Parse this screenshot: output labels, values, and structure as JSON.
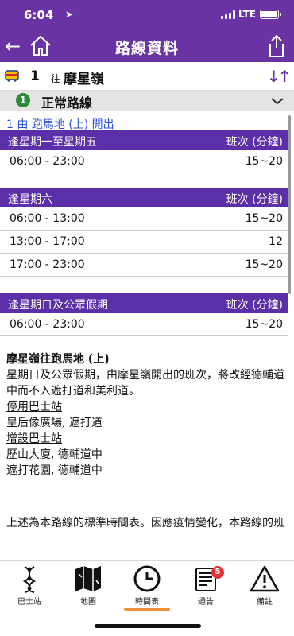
{
  "status_bar": {
    "time": "6:04",
    "network": "LTE"
  },
  "header": {
    "title": "路線資料"
  },
  "route": {
    "number": "1",
    "direction_prefix": "往",
    "destination": "摩星嶺"
  },
  "variant": {
    "index": "1",
    "label": "正常路線"
  },
  "origin_text": "1 由 跑馬地 (上) 開出",
  "timetable": [
    {
      "day_label": "逢星期一至星期五",
      "freq_label": "班次 (分鐘)",
      "rows": [
        {
          "time": "06:00 - 23:00",
          "freq": "15~20"
        }
      ]
    },
    {
      "day_label": "逢星期六",
      "freq_label": "班次 (分鐘)",
      "rows": [
        {
          "time": "06:00 - 13:00",
          "freq": "15~20"
        },
        {
          "time": "13:00 - 17:00",
          "freq": "12"
        },
        {
          "time": "17:00 - 23:00",
          "freq": "15~20"
        }
      ]
    },
    {
      "day_label": "逢星期日及公眾假期",
      "freq_label": "班次 (分鐘)",
      "rows": [
        {
          "time": "06:00 - 23:00",
          "freq": "15~20"
        }
      ]
    }
  ],
  "notes": {
    "heading": "摩星嶺往跑馬地 (上)",
    "body": "星期日及公眾假期，由摩星嶺開出的班次，將改經德輔道中而不入遮打道和美利道。",
    "suspended_label": "停用巴士站",
    "suspended_stop": "皇后像廣場, 遮打道",
    "added_label": "增設巴士站",
    "added_stop_1": "歷山大廈, 德輔道中",
    "added_stop_2": "遮打花園, 德輔道中"
  },
  "disclaimer": "上述為本路線的標準時間表。因應疫情變化，本路線的班",
  "tabs": [
    {
      "label": "巴士站",
      "icon": "bus-stop-icon"
    },
    {
      "label": "地圖",
      "icon": "map-icon"
    },
    {
      "label": "時間表",
      "icon": "clock-icon"
    },
    {
      "label": "通告",
      "icon": "notice-icon",
      "badge": "5"
    },
    {
      "label": "備註",
      "icon": "warning-icon"
    }
  ],
  "colors": {
    "brand": "#6a33a3",
    "table_header": "#5b2fa8",
    "link": "#2a4fd6",
    "active_tab": "#f0903a",
    "badge": "#e63030"
  }
}
